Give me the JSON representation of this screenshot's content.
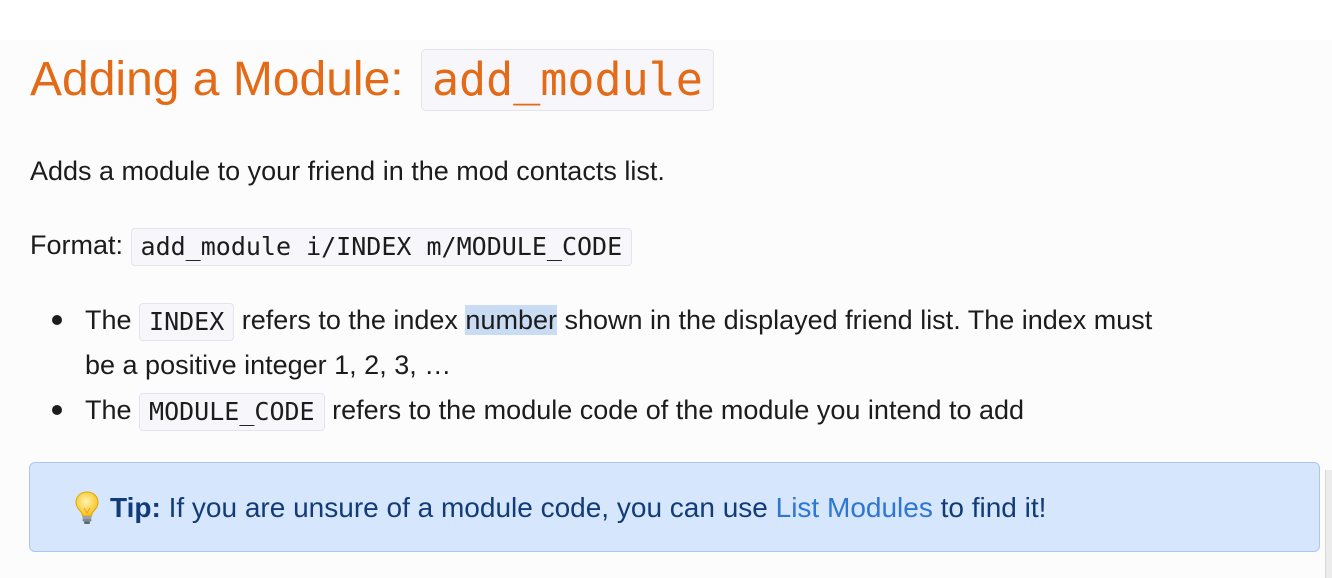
{
  "heading": {
    "text": "Adding a Module: ",
    "code": "add_module"
  },
  "intro": "Adds a module to your friend in the mod contacts list.",
  "format": {
    "label": "Format: ",
    "code": "add_module i/INDEX m/MODULE_CODE"
  },
  "bullets": [
    {
      "prefix": "The ",
      "code": "INDEX",
      "text_before_highlight": " refers to the index ",
      "highlighted": "number",
      "text_after_highlight": " shown in the displayed friend list. The index must",
      "continuation": "be a positive integer 1, 2, 3, …"
    },
    {
      "prefix": "The ",
      "code": "MODULE_CODE",
      "text": " refers to the module code of the module you intend to add"
    }
  ],
  "tip": {
    "icon": "lightbulb-icon",
    "label": "Tip:",
    "text_before_link": " If you are unsure of a module code, you can use ",
    "link_text": "List Modules",
    "text_after_link": " to find it!"
  },
  "colors": {
    "heading": "#e36a16",
    "tip_background": "#d6e6fd",
    "tip_border": "#a9c8f1",
    "tip_text": "#123c78",
    "link": "#2d77d2",
    "selection_highlight": "#c9dcf3"
  }
}
